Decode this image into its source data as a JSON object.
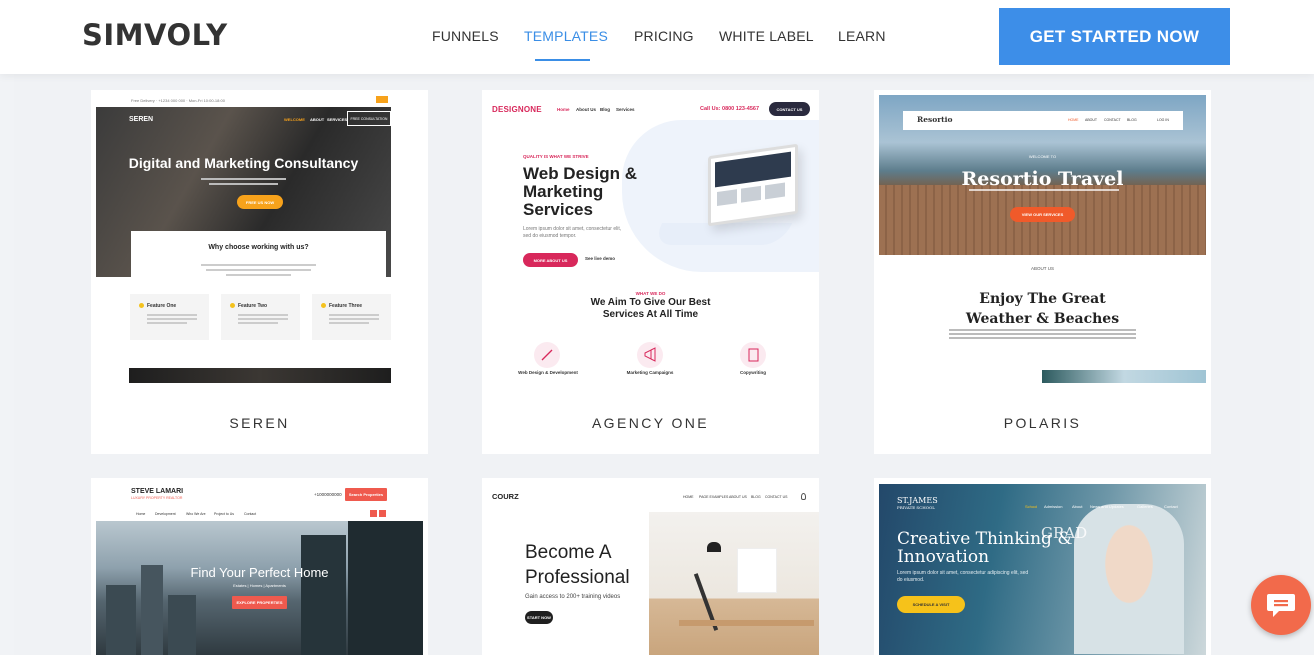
{
  "header": {
    "logo": "SIMVOLY",
    "nav": [
      {
        "label": "FUNNELS"
      },
      {
        "label": "TEMPLATES",
        "active": true
      },
      {
        "label": "PRICING"
      },
      {
        "label": "WHITE LABEL"
      },
      {
        "label": "LEARN"
      }
    ],
    "cta": "GET STARTED NOW"
  },
  "templates": [
    {
      "name": "SEREN",
      "preview": {
        "brand": "SEREN",
        "nav": [
          "WELCOME",
          "ABOUT",
          "SERVICES",
          "FREE CONSULTATION"
        ],
        "hero_title": "Digital and Marketing Consultancy",
        "hero_button": "FREE US NOW",
        "section_title": "Why choose working with us?",
        "features": [
          "Feature One",
          "Feature Two",
          "Feature Three"
        ]
      }
    },
    {
      "name": "AGENCY ONE",
      "preview": {
        "brand": "DESIGNONE",
        "nav": [
          "Home",
          "About Us",
          "Blog",
          "Services"
        ],
        "phone": "Call Us: 0800 123-4567",
        "contact_button": "CONTACT US",
        "kicker": "QUALITY IS WHAT WE STRIVE",
        "hero_title_lines": [
          "Web Design &",
          "Marketing",
          "Services"
        ],
        "hero_text": "Lorem ipsum dolor sit amet, consectetur elit, sed do eiusmod tempor.",
        "more_button": "MORE ABOUT US",
        "demo_link": "See live demo",
        "section_kicker": "WHAT WE DO",
        "section_title_lines": [
          "We Aim To Give Our Best",
          "Services At All Time"
        ],
        "services": [
          "Web Design & Development",
          "Marketing Campaigns",
          "Copywriting"
        ]
      }
    },
    {
      "name": "POLARIS",
      "preview": {
        "brand": "Resortio",
        "nav": [
          "HOME",
          "ABOUT",
          "CONTACT",
          "BLOG",
          "LOG IN"
        ],
        "welcome": "WELCOME TO",
        "hero_title": "Resortio Travel",
        "hero_button": "VIEW OUR SERVICES",
        "about_kicker": "ABOUT US",
        "about_title_lines": [
          "Enjoy The Great",
          "Weather & Beaches"
        ]
      }
    },
    {
      "name": "",
      "preview": {
        "brand": "STEVE LAMARI",
        "tagline": "LUXURY PROPERTY REALTOR",
        "phone": "+1000000000",
        "cta": "Search Properties",
        "nav": [
          "Home",
          "Development",
          "Who We Are",
          "Project to Us",
          "Contact"
        ],
        "hero_title": "Find Your Perfect Home",
        "hero_sub": "Estates | Homes | Apartments",
        "hero_button": "EXPLORE PROPERTIES"
      }
    },
    {
      "name": "",
      "preview": {
        "brand": "COURZ",
        "nav": [
          "HOME",
          "PAGE EXAMPLES",
          "ABOUT US",
          "BLOG",
          "CONTACT US"
        ],
        "hero_title_lines": [
          "Become A",
          "Professional"
        ],
        "hero_sub": "Gain access to 200+ training videos",
        "hero_button": "START NOW"
      }
    },
    {
      "name": "",
      "preview": {
        "brand": "ST.JAMES",
        "brand_sub": "PRIVATE SCHOOL",
        "nav": [
          "School",
          "Admission",
          "About",
          "News and Updates",
          "Galleries",
          "Contact"
        ],
        "hero_title_lines": [
          "Creative Thinking &",
          "Innovation"
        ],
        "hero_text": "Lorem ipsum dolor sit amet, consectetur adipiscing elit, sed do eiusmod.",
        "hero_button": "SCHEDULE A VISIT",
        "overlay_text": "GRAD"
      }
    }
  ],
  "chat": {
    "icon": "chat-bubble-icon"
  },
  "colors": {
    "accent": "#3d8ee8",
    "chat": "#f26a4b",
    "agency_pink": "#d8285b",
    "seren_orange": "#f7a21b",
    "polaris_orange": "#f05a2a",
    "steve_red": "#ef5a4e",
    "stjames_yellow": "#f6c21a"
  }
}
